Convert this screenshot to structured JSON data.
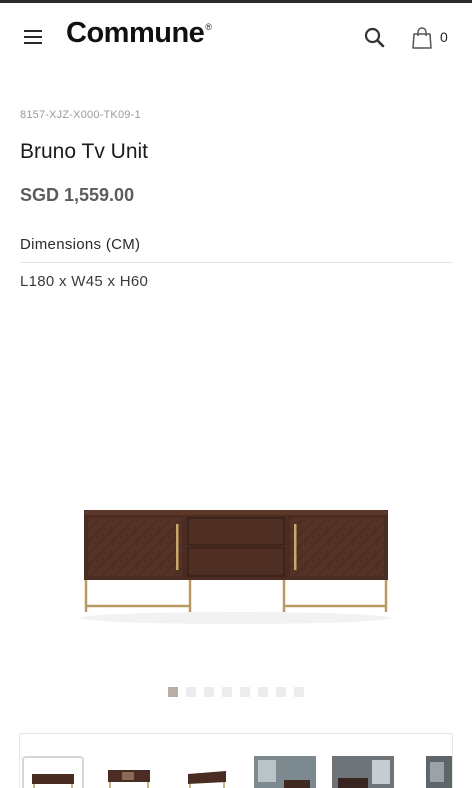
{
  "header": {
    "brand": "Commune",
    "brand_mark": "®",
    "cart_count": "0"
  },
  "product": {
    "sku": "8157-XJZ-X000-TK09-1",
    "name": "Bruno Tv Unit",
    "price": "SGD 1,559.00",
    "dimensions_label": "Dimensions (CM)",
    "dimensions_value": "L180 x W45 x H60"
  },
  "gallery": {
    "image_count": 8,
    "active_index": 0
  },
  "thumbnails": [
    "tv-unit-front",
    "tv-unit-open",
    "tv-unit-angle",
    "room-scene-1",
    "room-scene-2",
    "room-scene-3"
  ],
  "colors": {
    "wood": "#4a2c22",
    "brass": "#b99a63",
    "dot_active": "#b9aea4",
    "dot_inactive": "#ececec"
  },
  "icons": [
    "menu-icon",
    "search-icon",
    "shopping-bag-icon"
  ]
}
